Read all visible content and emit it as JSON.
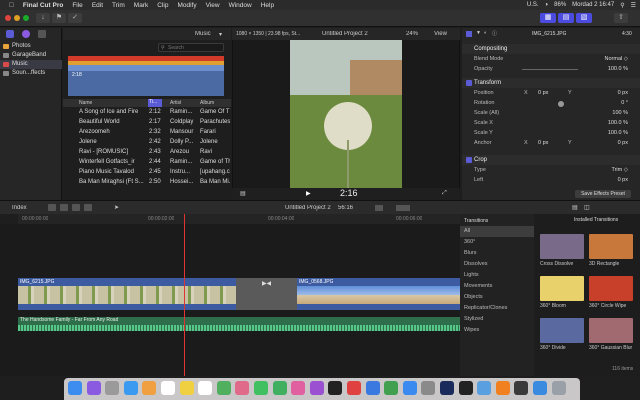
{
  "menubar": {
    "app": "Final Cut Pro",
    "items": [
      "File",
      "Edit",
      "Trim",
      "Mark",
      "Clip",
      "Modify",
      "View",
      "Window",
      "Help"
    ],
    "locale": "U.S.",
    "battery": "86%",
    "clock": "Mordad 2 16:47"
  },
  "sidebar": {
    "items": [
      {
        "label": "Photos",
        "icon": "photos-icon",
        "color": "#e8a33c"
      },
      {
        "label": "GarageBand",
        "icon": "folder-icon",
        "color": "#888888"
      },
      {
        "label": "Music",
        "icon": "music-icon",
        "color": "#d94a4a"
      },
      {
        "label": "Soun...ffects",
        "icon": "folder-icon",
        "color": "#888888"
      }
    ]
  },
  "browser": {
    "title": "Music",
    "search_placeholder": "Search",
    "waveform_time": "2:18",
    "columns": [
      "Name",
      "Ti...",
      "Artist",
      "Album"
    ],
    "rows": [
      {
        "name": "A Song of Ice and Fire",
        "time": "2:12",
        "artist": "Ramin...",
        "album": "Game Of Th..."
      },
      {
        "name": "Beautiful World",
        "time": "2:17",
        "artist": "Coldplay",
        "album": "Parachutes"
      },
      {
        "name": "Arezoomeh",
        "time": "2:32",
        "artist": "Mansour",
        "album": "Farari"
      },
      {
        "name": "Jolene",
        "time": "2:42",
        "artist": "Dolly P...",
        "album": "Jolene"
      },
      {
        "name": "Ravi - [ROMUSIC]",
        "time": "2:43",
        "artist": "Arezou",
        "album": "Ravi"
      },
      {
        "name": "Winterfell Gotfacts_ir",
        "time": "2:44",
        "artist": "Ramin...",
        "album": "Game of Th..."
      },
      {
        "name": "Piano Music Tavalod",
        "time": "2:45",
        "artist": "Instru...",
        "album": "[upahang.c..."
      },
      {
        "name": "Ba Man Miraghsi (Ft S...",
        "time": "2:50",
        "artist": "Hossei...",
        "album": "Ba Man Mi..."
      }
    ]
  },
  "viewer": {
    "format": "1080 × 1350 | 23.98 fps, St...",
    "project": "Untitled Project 2",
    "zoom": "24%",
    "view": "View",
    "timecode": "2:16"
  },
  "inspector": {
    "filename": "IMG_6215.JPG",
    "duration": "4:30",
    "compositing": {
      "section": "Compositing",
      "blend_label": "Blend Mode",
      "blend_value": "Normal ◇",
      "opacity_label": "Opacity",
      "opacity_value": "100.0 %"
    },
    "transform": {
      "section": "Transform",
      "position_label": "Position",
      "position_x_axis": "X",
      "position_x": "0 px",
      "position_y_axis": "Y",
      "position_y": "0 px",
      "rotation_label": "Rotation",
      "rotation": "0 °",
      "scale_all_label": "Scale (All)",
      "scale_all": "100 %",
      "scale_x_label": "Scale X",
      "scale_x": "100.0 %",
      "scale_y_label": "Scale Y",
      "scale_y": "100.0 %",
      "anchor_label": "Anchor",
      "anchor_x_axis": "X",
      "anchor_x": "0 px",
      "anchor_y_axis": "Y",
      "anchor_y": "0 px"
    },
    "crop": {
      "section": "Crop",
      "type_label": "Type",
      "type_value": "Trim ◇",
      "left_label": "Left",
      "left_value": "0 px"
    },
    "save_button": "Save Effects Preset"
  },
  "timeline": {
    "index_label": "Index",
    "project": "Untitled Project 2",
    "duration": "56:16",
    "ruler": [
      "00:00:00:00",
      "00:00:02:00",
      "00:00:04:00",
      "00:00:06:00"
    ],
    "clip1_label": "IMG_6215.JPG",
    "clip2_label": "IMG_0568.JPG",
    "audio_label": "The Handsome Family - Far From Any Road"
  },
  "transitions": {
    "header": "Transitions",
    "installed": "Installed Transitions",
    "categories": [
      "All",
      "360°",
      "Blurs",
      "Dissolves",
      "Lights",
      "Movements",
      "Objects",
      "Replicator/Clones",
      "Stylized",
      "Wipes"
    ],
    "items": [
      {
        "label": "Cross Dissolve",
        "color": "#7a6a8a"
      },
      {
        "label": "3D Rectangle",
        "color": "#c8783a"
      },
      {
        "label": "360° Bloom",
        "color": "#e8d06a"
      },
      {
        "label": "360° Circle Wipe",
        "color": "#c8402a"
      },
      {
        "label": "360° Divide",
        "color": "#5a6aa0"
      },
      {
        "label": "360° Gaussian Blur",
        "color": "#a06a70"
      }
    ],
    "count": "116 items"
  },
  "dock": {
    "apps": [
      "finder-icon",
      "siri-icon",
      "launchpad-icon",
      "safari-icon",
      "photos-icon",
      "calendar-icon",
      "notes-icon",
      "reminders-icon",
      "maps-icon",
      "photos-app-icon",
      "messages-icon",
      "facetime-icon",
      "itunes-icon",
      "podcasts-icon",
      "tv-icon",
      "news-icon",
      "keynote-icon",
      "numbers-icon",
      "app-store-icon",
      "settings-icon",
      "photoshop-icon",
      "terminal-icon",
      "preview-icon",
      "vlc-icon",
      "final-cut-icon",
      "folder-icon",
      "trash-icon"
    ],
    "colors": [
      "#3d8df0",
      "#8a5ae0",
      "#9a9a9a",
      "#3a9af0",
      "#f0a040",
      "#ffffff",
      "#f0d040",
      "#ffffff",
      "#50b060",
      "#e06a8a",
      "#40c060",
      "#40b060",
      "#e060a0",
      "#9a50d0",
      "#222222",
      "#e04040",
      "#3a7ae0",
      "#40a050",
      "#3a8af0",
      "#8a8a8a",
      "#1a2a5a",
      "#222222",
      "#5aa0e0",
      "#f08020",
      "#3a3a3a",
      "#3a8ae0",
      "#9aa0a8"
    ]
  }
}
